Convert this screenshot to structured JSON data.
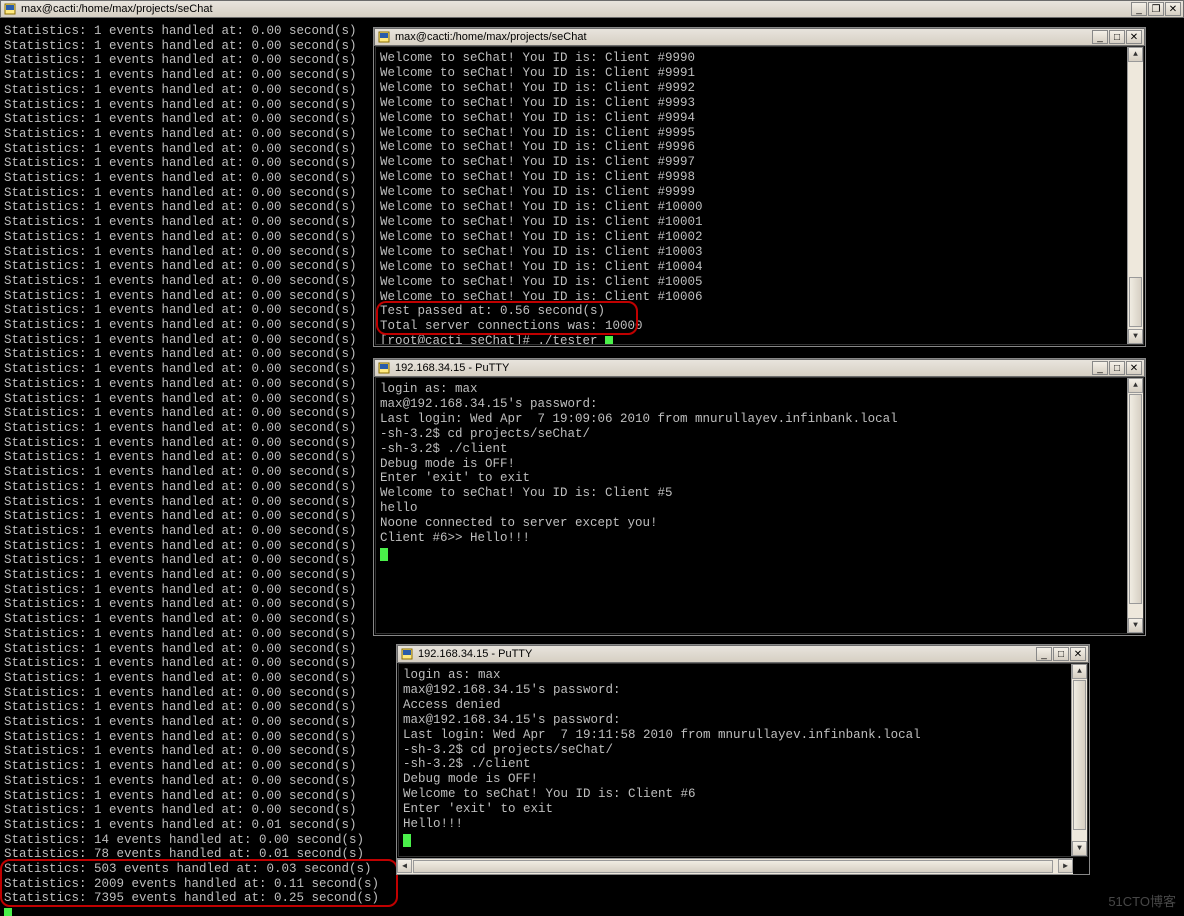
{
  "root": {
    "title": "max@cacti:/home/max/projects/seChat",
    "stats_base": "Statistics: 1 events handled at: 0.00 second(s)",
    "stats_base_count": 54,
    "stats_tail": [
      "Statistics: 1 events handled at: 0.01 second(s)",
      "Statistics: 14 events handled at: 0.00 second(s)",
      "Statistics: 78 events handled at: 0.01 second(s)"
    ],
    "stats_highlight": [
      "Statistics: 503 events handled at: 0.03 second(s)",
      "Statistics: 2009 events handled at: 0.11 second(s)",
      "Statistics: 7395 events handled at: 0.25 second(s)"
    ]
  },
  "sub1": {
    "title": "max@cacti:/home/max/projects/seChat",
    "welcome_prefix": "Welcome to seChat! You ID is: Client #",
    "first_id": 9990,
    "last_id": 10006,
    "hl1": "Test passed at: 0.56 second(s)",
    "hl2": "Total server connections was: 10000",
    "prompt": "[root@cacti seChat]# ./tester "
  },
  "sub2": {
    "title": "192.168.34.15 - PuTTY",
    "lines": [
      "login as: max",
      "max@192.168.34.15's password:",
      "Last login: Wed Apr  7 19:09:06 2010 from mnurullayev.infinbank.local",
      "-sh-3.2$ cd projects/seChat/",
      "-sh-3.2$ ./client",
      "Debug mode is OFF!",
      "Enter 'exit' to exit",
      "Welcome to seChat! You ID is: Client #5",
      "hello",
      "Noone connected to server except you!",
      "Client #6>> Hello!!!"
    ]
  },
  "sub3": {
    "title": "192.168.34.15 - PuTTY",
    "lines": [
      "login as: max",
      "max@192.168.34.15's password:",
      "Access denied",
      "max@192.168.34.15's password:",
      "Last login: Wed Apr  7 19:11:58 2010 from mnurullayev.infinbank.local",
      "-sh-3.2$ cd projects/seChat/",
      "-sh-3.2$ ./client",
      "Debug mode is OFF!",
      "Welcome to seChat! You ID is: Client #6",
      "Enter 'exit' to exit",
      "Hello!!!"
    ]
  },
  "watermark": "51CTO博客"
}
